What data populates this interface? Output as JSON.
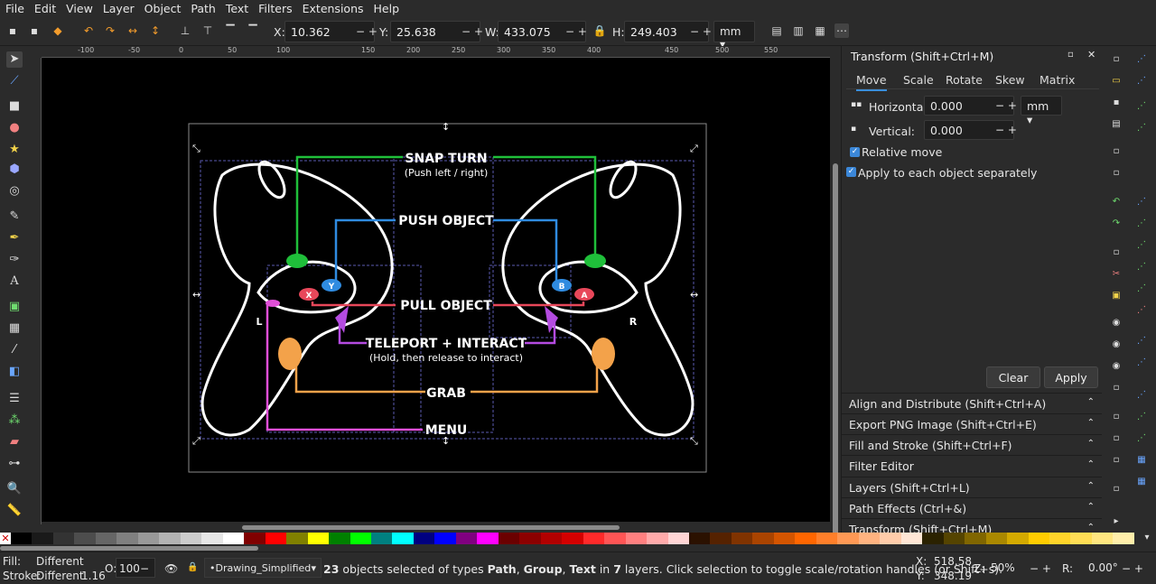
{
  "menu": [
    "File",
    "Edit",
    "View",
    "Layer",
    "Object",
    "Path",
    "Text",
    "Filters",
    "Extensions",
    "Help"
  ],
  "toolbar": {
    "x_label": "X:",
    "x_value": "10.362",
    "y_label": "Y:",
    "y_value": "25.638",
    "w_label": "W:",
    "w_value": "433.075",
    "h_label": "H:",
    "h_value": "249.403",
    "unit": "mm"
  },
  "ruler_labels": [
    "-100",
    "-50",
    "0",
    "50",
    "100",
    "150",
    "200",
    "250",
    "300",
    "350",
    "400",
    "450",
    "500",
    "550"
  ],
  "drawing": {
    "snap_turn": "SNAP TURN",
    "snap_turn_sub": "(Push left / right)",
    "push_object": "PUSH OBJECT",
    "pull_object": "PULL OBJECT",
    "teleport": "TELEPORT + INTERACT",
    "teleport_sub": "(Hold, then release to interact)",
    "grab": "GRAB",
    "menu": "MENU",
    "left": "L",
    "right": "R",
    "btn_x": "X",
    "btn_y": "Y",
    "btn_a": "A",
    "btn_b": "B",
    "colors": {
      "snap": "#1fbf3a",
      "push": "#2f8be0",
      "pull": "#e8475a",
      "teleport": "#b44be0",
      "grab": "#f3a24a",
      "menu": "#e04fd8"
    }
  },
  "panel": {
    "title": "Transform (Shift+Ctrl+M)",
    "tabs": [
      "Move",
      "Scale",
      "Rotate",
      "Skew",
      "Matrix"
    ],
    "horizontal_label": "Horizontal:",
    "horizontal_value": "0.000",
    "vertical_label": "Vertical:",
    "vertical_value": "0.000",
    "unit": "mm",
    "relative_move": "Relative move",
    "apply_each": "Apply to each object separately",
    "clear": "Clear",
    "apply": "Apply",
    "docks": [
      "Align and Distribute (Shift+Ctrl+A)",
      "Export PNG Image (Shift+Ctrl+E)",
      "Fill and Stroke (Shift+Ctrl+F)",
      "Filter Editor",
      "Layers (Shift+Ctrl+L)",
      "Path Effects (Ctrl+&)",
      "Transform (Shift+Ctrl+M)"
    ]
  },
  "palette": [
    "#000000",
    "#1a1a1a",
    "#333333",
    "#4d4d4d",
    "#666666",
    "#808080",
    "#999999",
    "#b3b3b3",
    "#cccccc",
    "#e6e6e6",
    "#ffffff",
    "#800000",
    "#ff0000",
    "#808000",
    "#ffff00",
    "#008000",
    "#00ff00",
    "#008080",
    "#00ffff",
    "#000080",
    "#0000ff",
    "#800080",
    "#ff00ff",
    "#6b0000",
    "#8c0000",
    "#b20000",
    "#d40000",
    "#ff2a2a",
    "#ff5555",
    "#ff8080",
    "#ffaaaa",
    "#ffd5d5",
    "#2b1100",
    "#552200",
    "#803300",
    "#aa4400",
    "#d45500",
    "#ff6600",
    "#ff7f2a",
    "#ff9955",
    "#ffb380",
    "#ffccaa",
    "#ffe6d5",
    "#2b2200",
    "#554400",
    "#806600",
    "#aa8800",
    "#d4aa00",
    "#ffcc00",
    "#ffd42a",
    "#ffdd55",
    "#ffe680",
    "#ffeeaa"
  ],
  "status": {
    "fill_label": "Fill:",
    "fill_value": "Different",
    "stroke_label": "Stroke:",
    "stroke_value": "Different",
    "stroke_width": "1.16",
    "opacity_label": "O:",
    "opacity_value": "100",
    "layer": "•Drawing_Simplified",
    "message_bold1": "23",
    "message1": " objects selected of types ",
    "message_bold2": "Path",
    "message2": ", ",
    "message_bold3": "Group",
    "message3": ", ",
    "message_bold4": "Text",
    "message4": " in ",
    "message_bold5": "7",
    "message5": " layers. Click selection to toggle scale/rotation handles (or Shift+s).",
    "x_label": "X:",
    "x_value": "518.58",
    "y_label": "Y:",
    "y_value": "348.19",
    "z_label": "Z:",
    "zoom": "50%",
    "r_label": "R:",
    "rotation": "0.00°"
  }
}
